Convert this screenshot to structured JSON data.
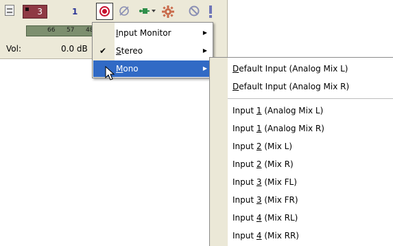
{
  "track": {
    "badge_number": "3",
    "number": "1",
    "meter_ticks": [
      "66",
      "57",
      "48"
    ],
    "volume_label": "Vol:",
    "volume_value": "0.0 dB"
  },
  "icons": {
    "collapse": "collapse-icon",
    "record": "record-arm-icon",
    "phase": "phase-invert-icon",
    "input_routing": "input-routing-icon",
    "fx": "fx-gear-icon",
    "mute": "mute-icon",
    "solo": "solo-exclamation-icon"
  },
  "colors": {
    "track_badge": "#8f3a44",
    "record": "#c8102e",
    "menu_highlight": "#316ac5",
    "meter": "#7d8f6f",
    "track_number": "#2a3496"
  },
  "input_menu": {
    "items": [
      {
        "label": "Input Monitor",
        "mnemonic": "I",
        "rest": "nput Monitor",
        "has_submenu": true,
        "checked": false
      },
      {
        "label": "Stereo",
        "mnemonic": "S",
        "rest": "tereo",
        "has_submenu": true,
        "checked": true
      },
      {
        "label": "Mono",
        "mnemonic": "M",
        "rest": "ono",
        "has_submenu": true,
        "checked": false,
        "active": true
      }
    ],
    "check_glyph": "✔",
    "arrow_glyph": "▶"
  },
  "mono_submenu": {
    "default_items": [
      {
        "mnemonic": "D",
        "rest": "efault Input (Analog Mix L)"
      },
      {
        "mnemonic": "D",
        "rest": "efault Input (Analog Mix R)"
      }
    ],
    "input_items": [
      {
        "prefix": "Input ",
        "mnemonic": "1",
        "rest": " (Analog Mix L)"
      },
      {
        "prefix": "Input ",
        "mnemonic": "1",
        "rest": " (Analog Mix R)"
      },
      {
        "prefix": "Input ",
        "mnemonic": "2",
        "rest": " (Mix L)"
      },
      {
        "prefix": "Input ",
        "mnemonic": "2",
        "rest": " (Mix R)"
      },
      {
        "prefix": "Input ",
        "mnemonic": "3",
        "rest": " (Mix FL)"
      },
      {
        "prefix": "Input ",
        "mnemonic": "3",
        "rest": " (Mix FR)"
      },
      {
        "prefix": "Input ",
        "mnemonic": "4",
        "rest": " (Mix RL)"
      },
      {
        "prefix": "Input ",
        "mnemonic": "4",
        "rest": " (Mix RR)"
      }
    ]
  }
}
